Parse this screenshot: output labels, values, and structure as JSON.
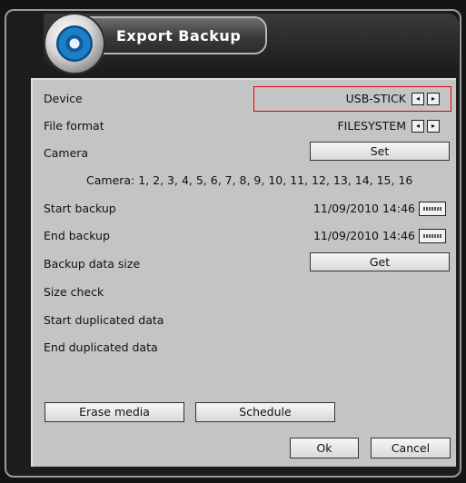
{
  "window": {
    "title": "Export Backup"
  },
  "rows": {
    "device": {
      "label": "Device",
      "value": "USB-STICK"
    },
    "file_format": {
      "label": "File format",
      "value": "FILESYSTEM"
    },
    "camera": {
      "label": "Camera",
      "button": "Set"
    },
    "camera_list": "Camera: 1, 2, 3, 4, 5, 6, 7, 8, 9, 10, 11, 12, 13, 14, 15, 16",
    "start_backup": {
      "label": "Start backup",
      "value": "11/09/2010 14:46"
    },
    "end_backup": {
      "label": "End backup",
      "value": "11/09/2010 14:46"
    },
    "backup_data_size": {
      "label": "Backup data size",
      "button": "Get"
    },
    "size_check": {
      "label": "Size check"
    },
    "start_duplicated": {
      "label": "Start duplicated data"
    },
    "end_duplicated": {
      "label": "End duplicated data"
    }
  },
  "buttons": {
    "erase_media": "Erase media",
    "schedule": "Schedule",
    "ok": "Ok",
    "cancel": "Cancel"
  },
  "icons": {
    "prev": "◂",
    "next": "▸"
  },
  "colors": {
    "panel": "#c4c4c4",
    "frame": "#1c1c1c",
    "highlight": "#e00000"
  }
}
